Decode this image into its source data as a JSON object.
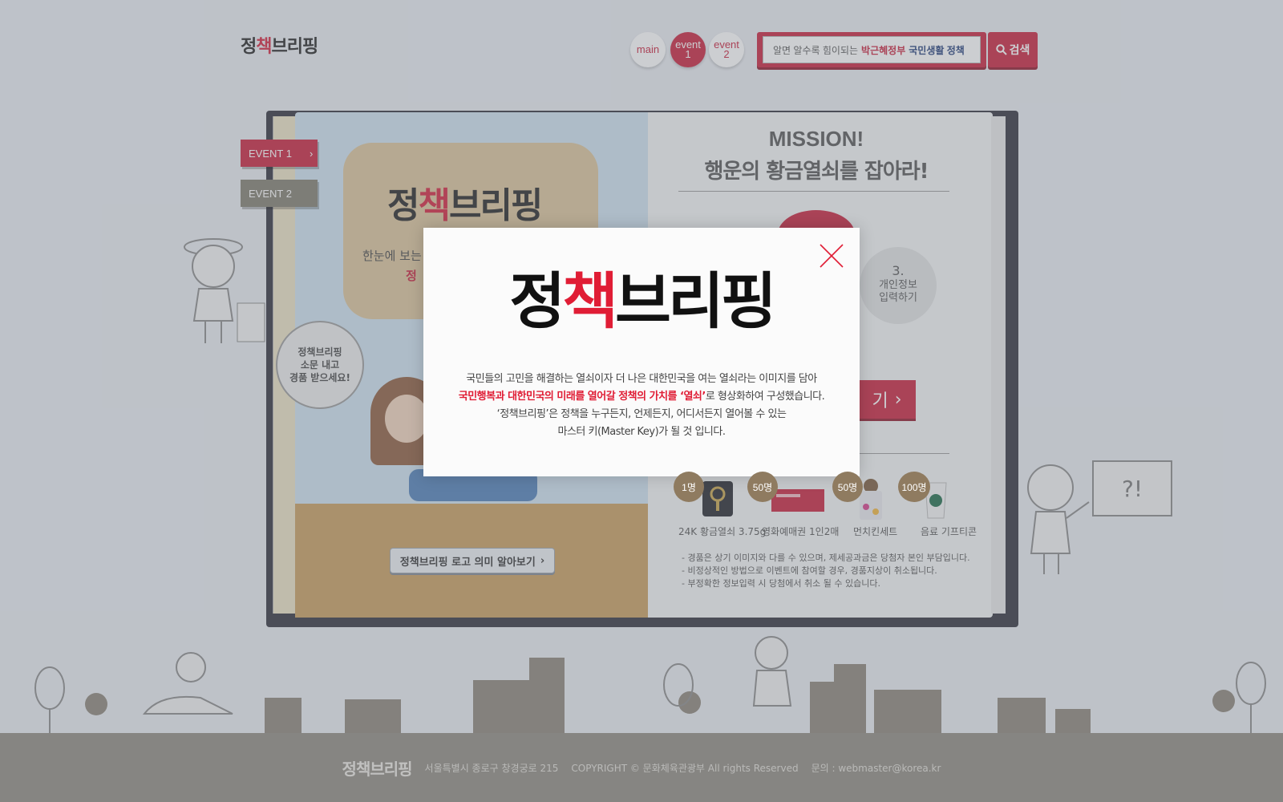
{
  "header": {
    "logo_pre": "정",
    "logo_red": "책",
    "logo_post": "브리핑",
    "nav": [
      {
        "label_line1": "main",
        "label_line2": ""
      },
      {
        "label_line1": "event",
        "label_line2": "1"
      },
      {
        "label_line1": "event",
        "label_line2": "2"
      }
    ],
    "search": {
      "text_prefix": "알면 알수록 힘이되는",
      "text_hl1": "박근혜정부",
      "text_hl2": "국민생활 정책",
      "button_label": "검색"
    }
  },
  "side_tabs": [
    {
      "label": "EVENT 1",
      "arrow": "›"
    },
    {
      "label": "EVENT 2",
      "arrow": ""
    }
  ],
  "book": {
    "left": {
      "card_title_pre": "정",
      "card_title_red": "책",
      "card_title_post": "브리핑",
      "card_sub": "한눈에 보는",
      "card_sub2": "정",
      "bubble_line1": "정책브리핑",
      "bubble_line2": "소문 내고",
      "bubble_line3": "경품 받으세요!",
      "meaning_button": "정책브리핑 로고 의미 알아보기",
      "meaning_arrow": "›"
    },
    "right": {
      "mission_line1": "MISSION!",
      "mission_line2": "행운의 황금열쇠를 잡아라!",
      "step3_num": "3.",
      "step3_line1": "개인정보",
      "step3_line2": "입력하기",
      "participate_label": "기",
      "participate_arrow": "›",
      "prizes": [
        {
          "count": "1명",
          "label": "24K 황금열쇠 3.75g"
        },
        {
          "count": "50명",
          "label": "영화예매권 1인2매"
        },
        {
          "count": "50명",
          "label": "먼치킨세트"
        },
        {
          "count": "100명",
          "label": "음료 기프티콘"
        }
      ],
      "notes": [
        "- 경품은 상기 이미지와 다를 수 있으며, 제세공과금은 당첨자 본인 부담입니다.",
        "- 비정상적인 방법으로 이벤트에 참여할 경우, 경품지상이 취소됩니다.",
        "- 부정확한 정보입력 시 당첨에서 취소 될 수 있습니다."
      ]
    }
  },
  "board_text": "?!",
  "footer": {
    "logo": "정책브리핑",
    "address": "서울특별시 종로구 창경궁로 215",
    "copyright": "COPYRIGHT © 문화체육관광부 All rights Reserved",
    "contact": "문의 : webmaster@korea.kr"
  },
  "modal": {
    "logo_pre": "정",
    "logo_red": "책",
    "logo_post": "브리핑",
    "line1": "국민들의 고민을 해결하는 열쇠이자 더 나은 대한민국을 여는 열쇠라는 이미지를 담아",
    "line2_red": "국민행복과 대한민국의 미래를 열어갈 정책의 가치를 ‘열쇠’",
    "line2_rest": "로 형상화하여 구성했습니다.",
    "line3": "‘정책브리핑’은 정책을 누구든지, 언제든지, 어디서든지 열어볼 수 있는",
    "line4": "마스터 키(Master Key)가 될 것 입니다."
  },
  "colors": {
    "brand_red": "#c8203a",
    "logo_red": "#e01d35",
    "footer_bg": "#8f8a80"
  }
}
